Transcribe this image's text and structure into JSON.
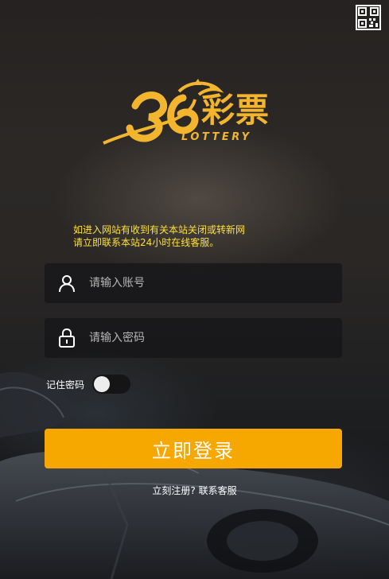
{
  "logo": {
    "chinese_text": "彩票",
    "english_text": "LOTTERY",
    "brand_color": "#f3b52e"
  },
  "notice": {
    "line1": "如进入网站有收到有关本站关闭或转新网",
    "line2": "请立即联系本站24小时在线客服。",
    "color": "#ffe13a"
  },
  "form": {
    "account_placeholder": "请输入账号",
    "password_placeholder": "请输入密码",
    "remember_label": "记住密码",
    "remember_enabled": false
  },
  "login_button": {
    "label": "立即登录",
    "color": "#f7a800"
  },
  "links": {
    "register": "立刻注册?",
    "contact": "联系客服"
  },
  "icons": {
    "top_right": "qr-code-icon",
    "account": "user-icon",
    "password": "lock-icon"
  }
}
